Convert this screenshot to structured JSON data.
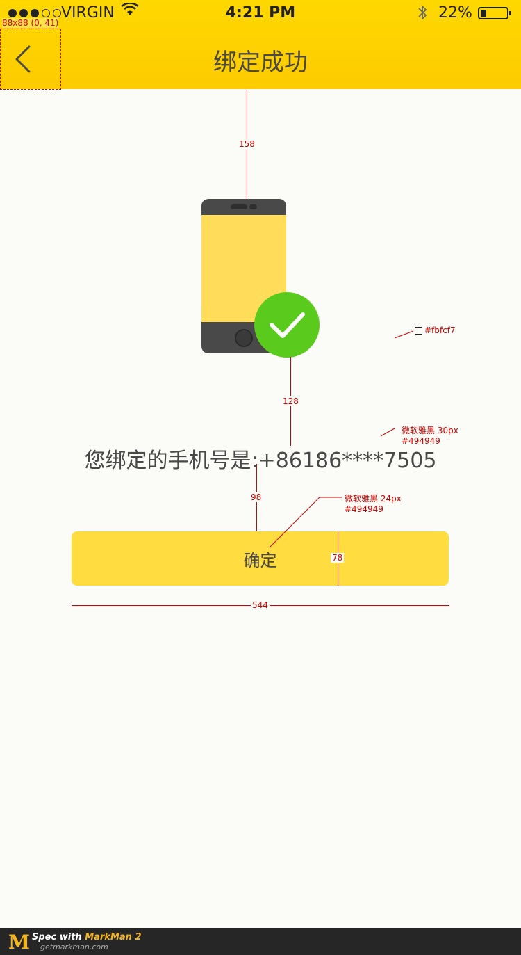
{
  "status_bar": {
    "carrier": "VIRGIN",
    "time": "4:21 PM",
    "battery": "22%",
    "signal_bars_filled": 3,
    "signal_bars_total": 5,
    "battery_level": 0.22
  },
  "nav": {
    "title": "绑定成功",
    "back_icon": "chevron-left-icon"
  },
  "illustration": {
    "phone_icon": "mobile-phone-icon",
    "check_icon": "check-circle-icon",
    "colors": {
      "phone_body": "#494949",
      "phone_screen": "#ffdc5a",
      "check": "#5acb1c"
    }
  },
  "message": {
    "prefix": "您绑定的手机号是:",
    "phone": "+86186****7505"
  },
  "confirm_button": {
    "label": "确定"
  },
  "colors": {
    "topbar": "#ffd800",
    "background": "#fbfcf7",
    "text": "#494949",
    "button": "#ffdc40",
    "annotation": "#d10000"
  },
  "spec": {
    "back_box": "88x88 (0, 41)",
    "gap_top": "158",
    "gap_mid": "128",
    "gap_btn": "98",
    "btn_height": "78",
    "btn_width": "544",
    "bg_color_label": "#fbfcf7",
    "text_font_1": "微软雅黑 30px",
    "text_color_1": "#494949",
    "text_font_2": "微软雅黑 24px",
    "text_color_2": "#494949"
  },
  "footer": {
    "logo": "M",
    "brand_prefix": "Spec with ",
    "brand_name": "MarkMan 2",
    "site": "getmarkman.com"
  }
}
